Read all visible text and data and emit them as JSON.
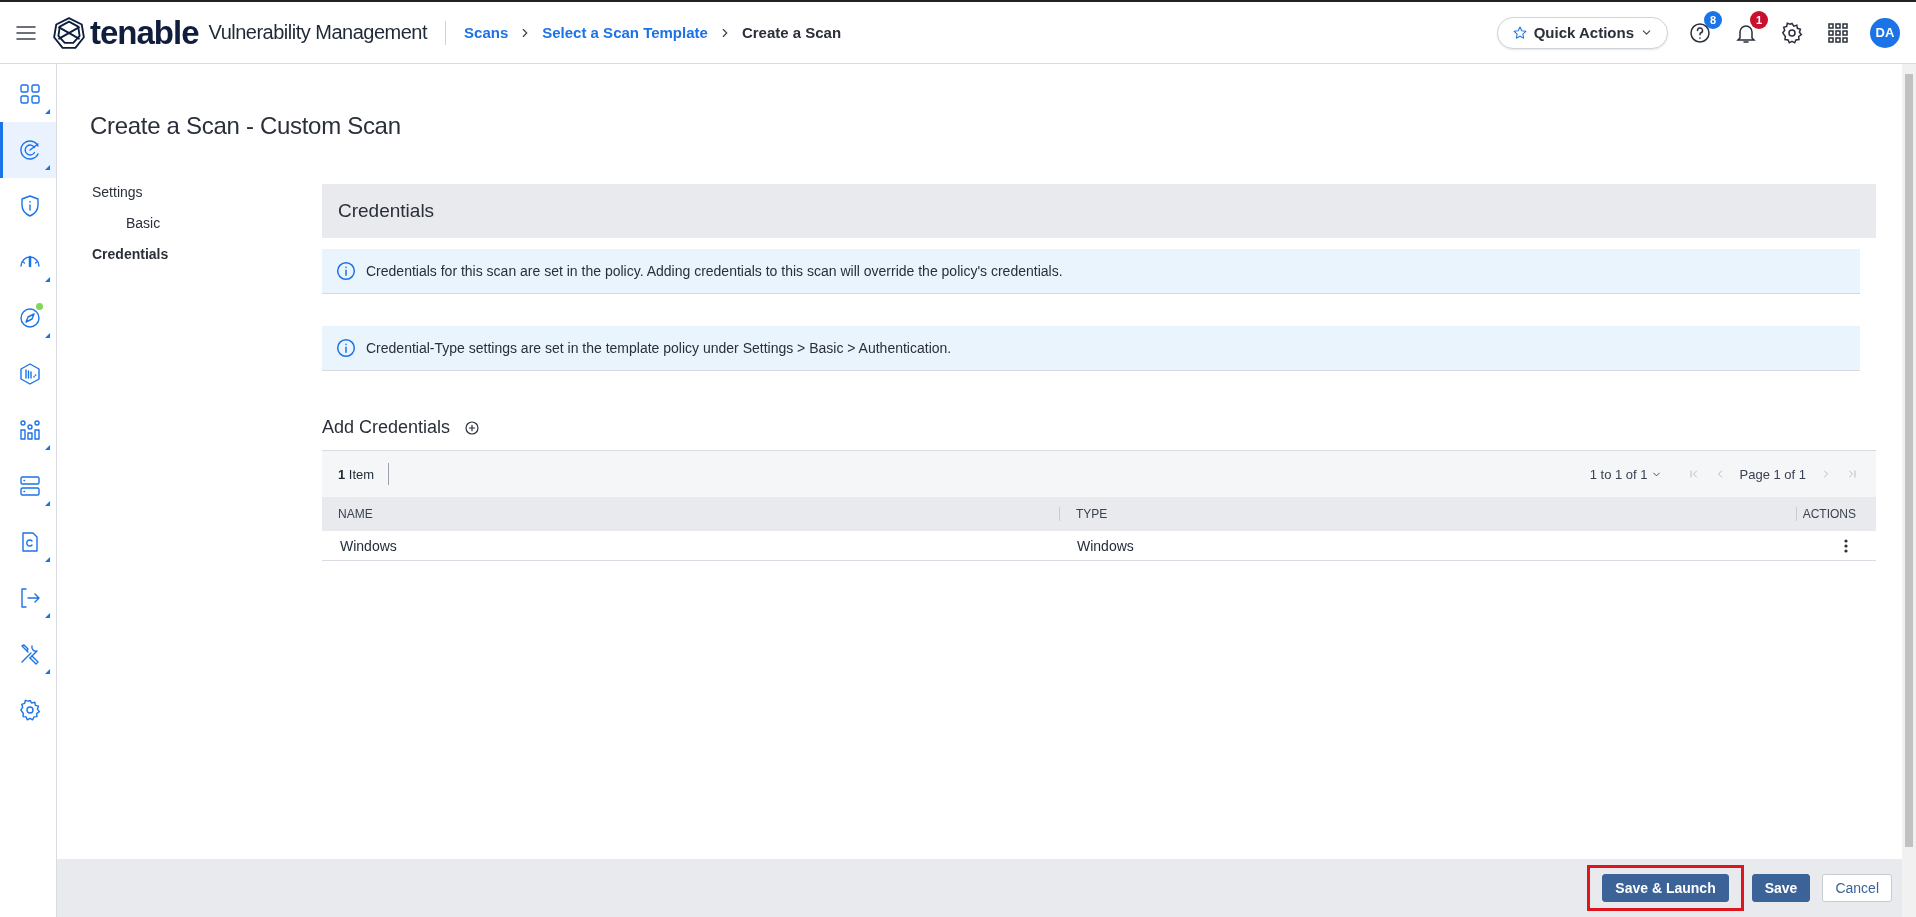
{
  "header": {
    "brand": "tenable",
    "product": "Vulnerability Management",
    "breadcrumbs": [
      {
        "label": "Scans",
        "link": true
      },
      {
        "label": "Select a Scan Template",
        "link": true
      },
      {
        "label": "Create a Scan",
        "link": false
      }
    ],
    "quick_actions": "Quick Actions",
    "help_badge": "8",
    "notifications_badge": "1",
    "avatar": "DA"
  },
  "sidebar": {
    "items": [
      {
        "kind": "grid",
        "selected": false,
        "expandable": true,
        "notification": false
      },
      {
        "kind": "scan",
        "selected": true,
        "expandable": true,
        "notification": false
      },
      {
        "kind": "shield",
        "selected": false,
        "expandable": false,
        "notification": false
      },
      {
        "kind": "gauge",
        "selected": false,
        "expandable": true,
        "notification": false
      },
      {
        "kind": "compass",
        "selected": false,
        "expandable": true,
        "notification": true
      },
      {
        "kind": "hexagon",
        "selected": false,
        "expandable": false,
        "notification": false
      },
      {
        "kind": "chart",
        "selected": false,
        "expandable": true,
        "notification": false
      },
      {
        "kind": "server",
        "selected": false,
        "expandable": true,
        "notification": false
      },
      {
        "kind": "document",
        "selected": false,
        "expandable": true,
        "notification": false
      },
      {
        "kind": "export",
        "selected": false,
        "expandable": true,
        "notification": false
      },
      {
        "kind": "tools",
        "selected": false,
        "expandable": true,
        "notification": false
      },
      {
        "kind": "gear",
        "selected": false,
        "expandable": false,
        "notification": false
      }
    ]
  },
  "page_title": "Create a Scan - Custom Scan",
  "nav": [
    {
      "label": "Settings",
      "selected": false,
      "children": [
        {
          "label": "Basic",
          "selected": false
        }
      ]
    },
    {
      "label": "Credentials",
      "selected": true
    }
  ],
  "section_title": "Credentials",
  "notices": [
    "Credentials for this scan are set in the policy. Adding credentials to this scan will override the policy's credentials.",
    "Credential-Type settings are set in the template policy under Settings > Basic > Authentication."
  ],
  "add_credentials": "Add Credentials",
  "table": {
    "count": "1",
    "count_label": "Item",
    "range": "1 to 1 of 1",
    "page": "Page 1 of 1",
    "columns": [
      "NAME",
      "TYPE",
      "ACTIONS"
    ],
    "rows": [
      [
        "Windows",
        "Windows"
      ]
    ]
  },
  "footer_buttons": [
    {
      "label": "Save & Launch",
      "kind": "primary",
      "highlighted": true
    },
    {
      "label": "Save",
      "kind": "primary",
      "highlighted": false
    },
    {
      "label": "Cancel",
      "kind": "secondary",
      "highlighted": false
    }
  ]
}
